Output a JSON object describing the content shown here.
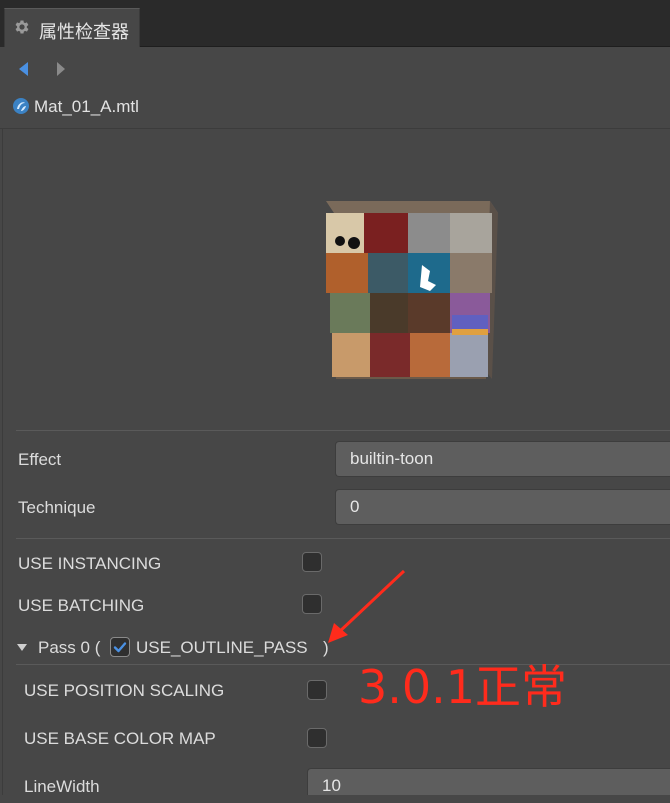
{
  "header": {
    "tab_title": "属性检查器"
  },
  "asset": {
    "name": "Mat_01_A.mtl"
  },
  "properties": {
    "effect_label": "Effect",
    "effect_value": "builtin-toon",
    "technique_label": "Technique",
    "technique_value": "0",
    "use_instancing_label": "USE  INSTANCING",
    "use_instancing_checked": false,
    "use_batching_label": "USE  BATCHING",
    "use_batching_checked": false
  },
  "pass": {
    "prefix": "Pass 0 (",
    "option_label": "USE_OUTLINE_PASS",
    "option_checked": true,
    "suffix": ")",
    "use_position_scaling_label": "USE  POSITION  SCALING",
    "use_position_scaling_checked": false,
    "use_base_color_map_label": "USE  BASE  COLOR  MAP",
    "use_base_color_map_checked": false,
    "linewidth_label": "LineWidth",
    "linewidth_value": "10"
  },
  "annotation": {
    "text": "3.0.1正常",
    "color": "#ff2b1c"
  },
  "colors": {
    "accent": "#4a90e2",
    "background": "#474747",
    "topbar": "#2a2a2a"
  }
}
